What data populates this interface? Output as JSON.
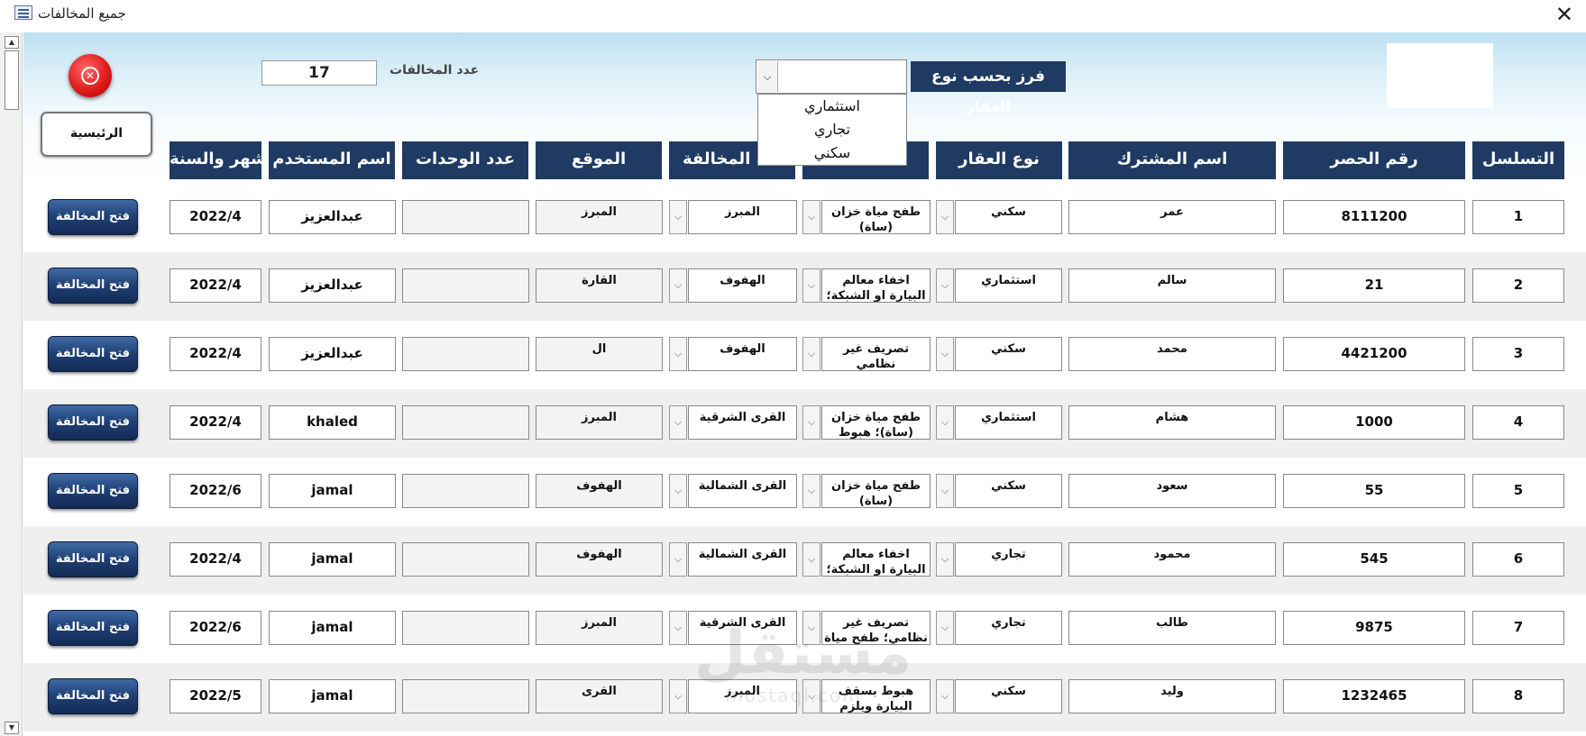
{
  "window": {
    "title": "جميع المخالفات",
    "close_glyph": "✕"
  },
  "form": {
    "count_label": "عدد المخالفات",
    "count_value": "17",
    "sort_label": "فرز بحسب نوع العقار",
    "sort_value": "",
    "sort_options": [
      "استثماري",
      "تجاري",
      "سكني"
    ],
    "home_button": "الرئيسية",
    "open_button": "فتح المخالفة"
  },
  "columns": [
    "التسلسل",
    "رقم الحصر",
    "اسم المشترك",
    "نوع العقار",
    "",
    "منطقة المخالفة",
    "الموقع",
    "عدد الوحدات",
    "اسم المستخدم",
    "الشهر والسنة"
  ],
  "rows": [
    {
      "seq": "1",
      "record": "8111200",
      "subscriber": "عمر",
      "property_type": "سكني",
      "violation": "طفح مياة خزان (ساة)",
      "area": "المبرز",
      "location": "المبرز",
      "units": "",
      "user": "عبدالعزيز",
      "month_year": "2022/4"
    },
    {
      "seq": "2",
      "record": "21",
      "subscriber": "سالم",
      "property_type": "استثماري",
      "violation": "اخفاء معالم البيارة او الشبكة؛ الوقوف",
      "area": "الهفوف",
      "location": "القارة",
      "units": "",
      "user": "عبدالعزيز",
      "month_year": "2022/4"
    },
    {
      "seq": "3",
      "record": "4421200",
      "subscriber": "محمد",
      "property_type": "سكني",
      "violation": "تصريف غير نظامي",
      "area": "الهفوف",
      "location": "ال",
      "units": "",
      "user": "عبدالعزيز",
      "month_year": "2022/4"
    },
    {
      "seq": "4",
      "record": "1000",
      "subscriber": "هشام",
      "property_type": "استثماري",
      "violation": "طفح مياة خزان (ساة)؛ هبوط",
      "area": "القرى الشرقية",
      "location": "المبرز",
      "units": "",
      "user": "khaled",
      "month_year": "2022/4"
    },
    {
      "seq": "5",
      "record": "55",
      "subscriber": "سعود",
      "property_type": "سكني",
      "violation": "طفح مياة خزان (ساة)",
      "area": "القرى الشمالية",
      "location": "الهفوف",
      "units": "",
      "user": "jamal",
      "month_year": "2022/6"
    },
    {
      "seq": "6",
      "record": "545",
      "subscriber": "محمود",
      "property_type": "تجاري",
      "violation": "اخفاء معالم البيارة او الشبكة؛ الوقوف",
      "area": "القرى الشمالية",
      "location": "الهفوف",
      "units": "",
      "user": "jamal",
      "month_year": "2022/4"
    },
    {
      "seq": "7",
      "record": "9875",
      "subscriber": "طالب",
      "property_type": "تجاري",
      "violation": "تصريف غير نظامي؛ طفح مياة",
      "area": "القرى الشرقية",
      "location": "المبرز",
      "units": "",
      "user": "jamal",
      "month_year": "2022/6"
    },
    {
      "seq": "8",
      "record": "1232465",
      "subscriber": "وليد",
      "property_type": "سكني",
      "violation": "هبوط بسقف البيارة ويلزم اصلاحها",
      "area": "المبرز",
      "location": "القرى",
      "units": "",
      "user": "jamal",
      "month_year": "2022/5"
    }
  ],
  "watermark": {
    "arabic": "مستقل",
    "latin": "mostaql.com"
  }
}
